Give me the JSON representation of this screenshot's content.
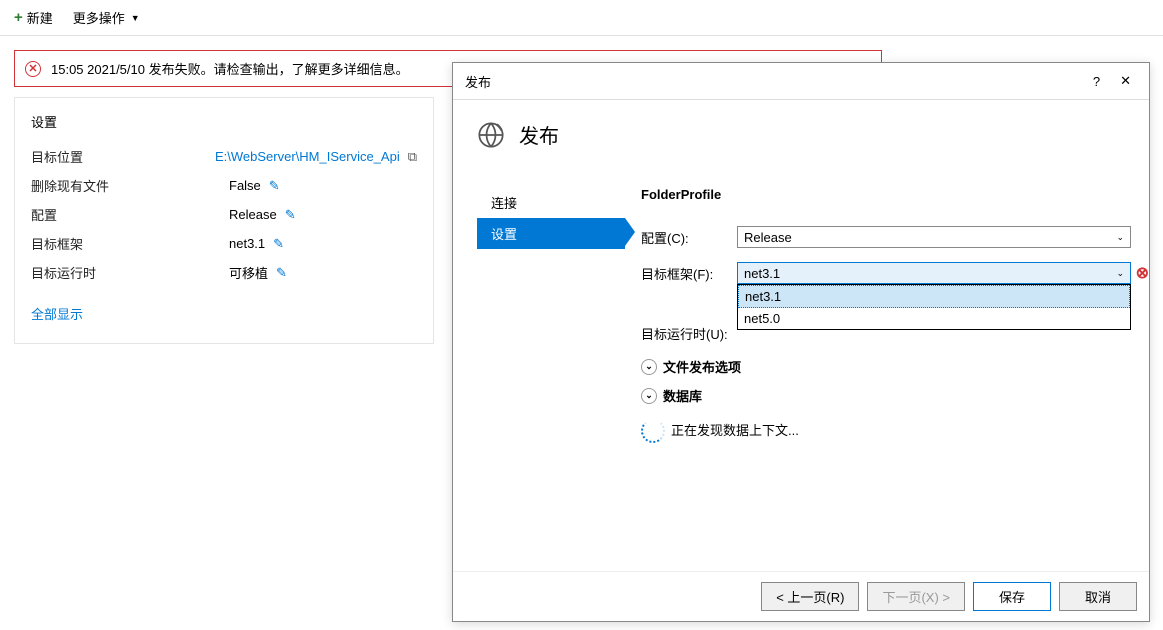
{
  "toolbar": {
    "new_label": "新建",
    "more_actions_label": "更多操作"
  },
  "error_banner": {
    "text": "15:05 2021/5/10 发布失败。请检查输出，了解更多详细信息。"
  },
  "settings_panel": {
    "title": "设置",
    "rows": {
      "target_location_label": "目标位置",
      "target_location_value": "E:\\WebServer\\HM_IService_Api",
      "delete_existing_label": "删除现有文件",
      "delete_existing_value": "False",
      "configuration_label": "配置",
      "configuration_value": "Release",
      "target_framework_label": "目标框架",
      "target_framework_value": "net3.1",
      "target_runtime_label": "目标运行时",
      "target_runtime_value": "可移植"
    },
    "show_all_label": "全部显示"
  },
  "dialog": {
    "titlebar_title": "发布",
    "help_symbol": "?",
    "close_symbol": "✕",
    "header_title": "发布",
    "sidebar": {
      "connection_label": "连接",
      "settings_label": "设置"
    },
    "main": {
      "profile_name": "FolderProfile",
      "config_label": "配置(C):",
      "config_value": "Release",
      "framework_label": "目标框架(F):",
      "framework_value": "net3.1",
      "runtime_label": "目标运行时(U):",
      "dropdown_options": [
        "net3.1",
        "net5.0"
      ],
      "file_publish_options_label": "文件发布选项",
      "database_label": "数据库",
      "loading_text": "正在发现数据上下文..."
    },
    "footer": {
      "prev_label": "< 上一页(R)",
      "next_label": "下一页(X) >",
      "save_label": "保存",
      "cancel_label": "取消"
    }
  }
}
